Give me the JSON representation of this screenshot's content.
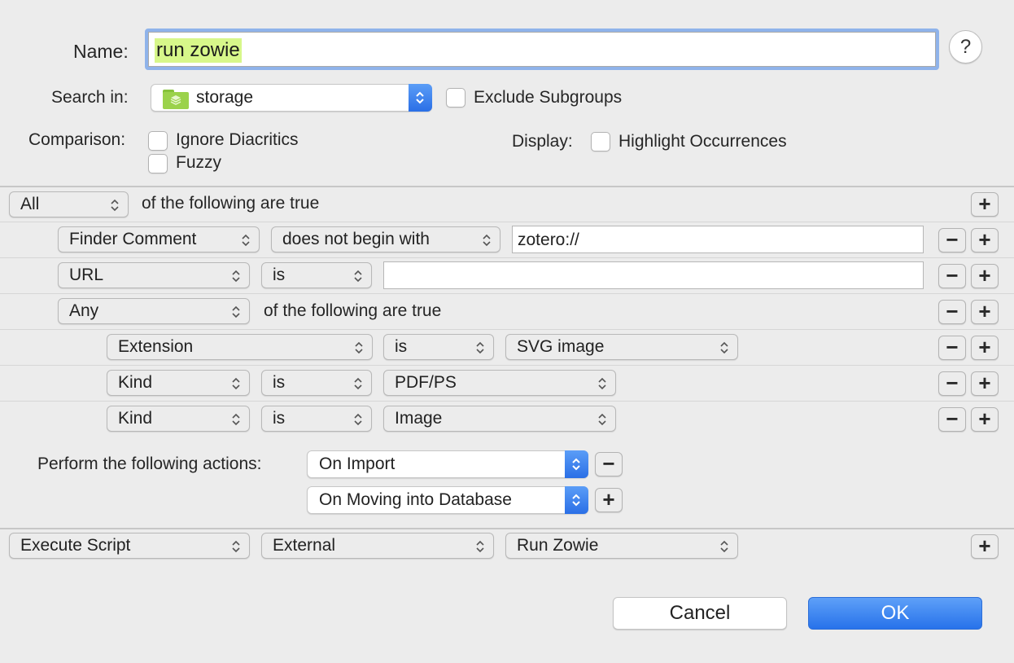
{
  "name": {
    "label": "Name:",
    "value": "run zowie"
  },
  "help": {
    "label": "?"
  },
  "search_in": {
    "label": "Search in:",
    "value": "storage",
    "exclude_label": "Exclude Subgroups"
  },
  "comparison": {
    "label": "Comparison:",
    "ignore_diacritics": "Ignore Diacritics",
    "fuzzy": "Fuzzy"
  },
  "display": {
    "label": "Display:",
    "highlight": "Highlight Occurrences"
  },
  "match": {
    "value": "All",
    "suffix": "of the following are true"
  },
  "rules": {
    "r1": {
      "field": "Finder Comment",
      "op": "does not begin with",
      "value": "zotero://"
    },
    "r2": {
      "field": "URL",
      "op": "is",
      "value": ""
    },
    "r3": {
      "field": "Any",
      "suffix": "of the following are true"
    },
    "r4": {
      "field": "Extension",
      "op": "is",
      "value": "SVG image"
    },
    "r5": {
      "field": "Kind",
      "op": "is",
      "value": "PDF/PS"
    },
    "r6": {
      "field": "Kind",
      "op": "is",
      "value": "Image"
    }
  },
  "actions": {
    "label": "Perform the following actions:",
    "trigger1": "On Import",
    "trigger2": "On Moving into Database",
    "action": "Execute Script",
    "source": "External",
    "script": "Run Zowie"
  },
  "buttons": {
    "cancel": "Cancel",
    "ok": "OK",
    "plus": "+",
    "minus": "−"
  },
  "colors": {
    "accent": "#2a6fe6",
    "highlight": "#d7f78a",
    "focus_ring": "#8fb3ea"
  }
}
